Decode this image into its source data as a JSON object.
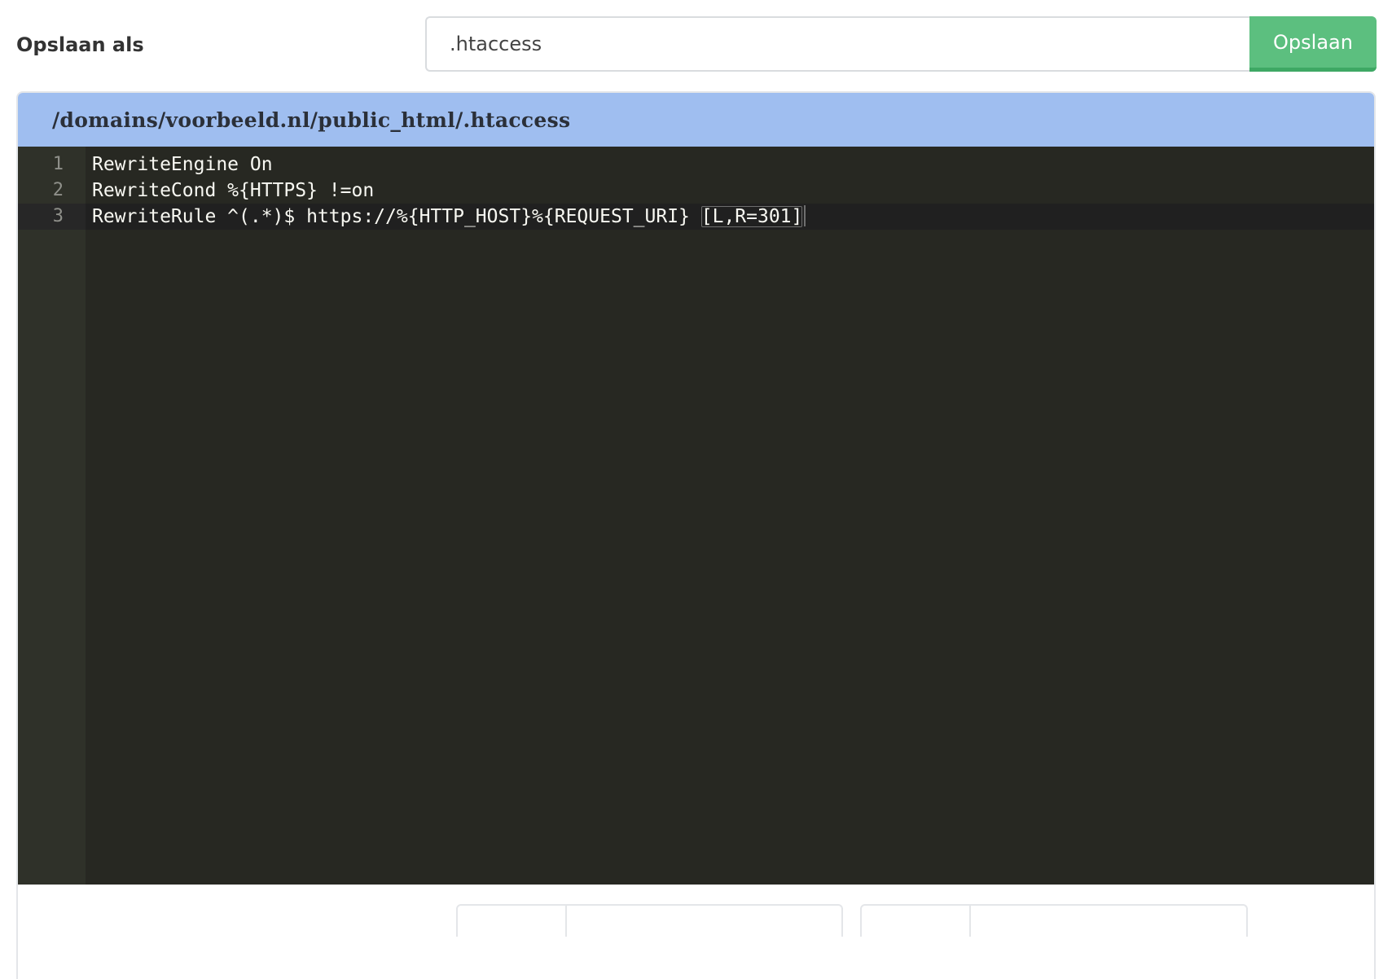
{
  "save_as": {
    "label": "Opslaan als",
    "filename_value": ".htaccess",
    "save_button_label": "Opslaan",
    "button_color": "#5cbf7f"
  },
  "editor": {
    "file_path": "/domains/voorbeeld.nl/public_html/.htaccess",
    "header_color": "#9fbef0",
    "theme_background": "#272822",
    "active_line": 3,
    "lines": [
      {
        "number": "1",
        "text": "RewriteEngine On"
      },
      {
        "number": "2",
        "text": "RewriteCond %{HTTPS} !=on"
      },
      {
        "number": "3",
        "text_before_bracket": "RewriteRule ^(.*)$ https://%{HTTP_HOST}%{REQUEST_URI} ",
        "text_bracketed": "[L,R=301]"
      }
    ]
  }
}
